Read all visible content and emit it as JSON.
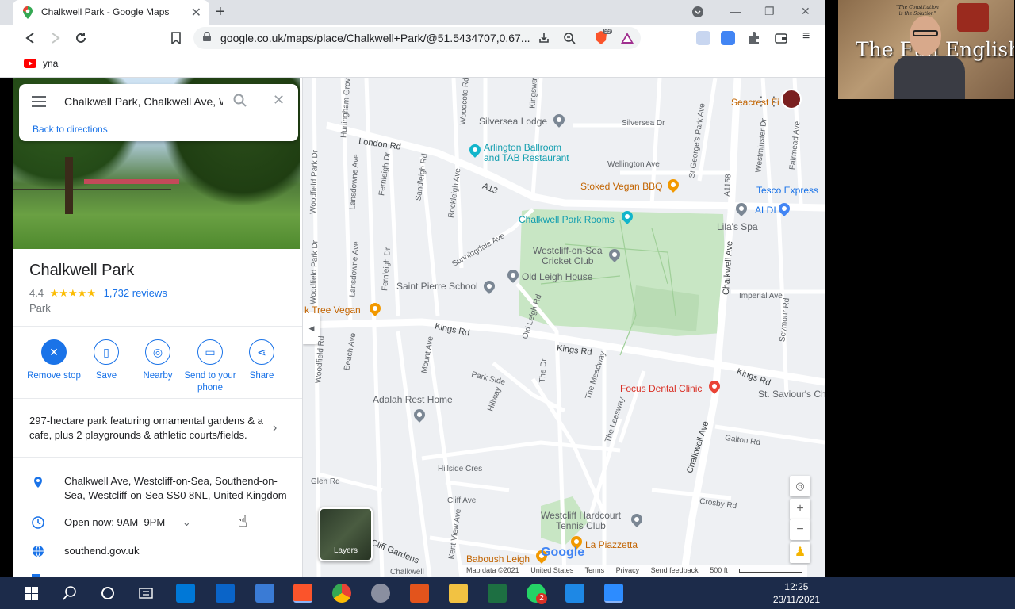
{
  "browser": {
    "tab_title": "Chalkwell Park - Google Maps",
    "url": "google.co.uk/maps/place/Chalkwell+Park/@51.5434707,0.67...",
    "bookmark_label": "yna",
    "brave_badge": "99"
  },
  "search": {
    "value": "Chalkwell Park, Chalkwell Ave, We",
    "back_link": "Back to directions"
  },
  "place": {
    "title": "Chalkwell Park",
    "rating": "4.4",
    "stars": "★★★★★",
    "reviews": "1,732 reviews",
    "type": "Park",
    "description": "297-hectare park featuring ornamental gardens & a cafe, plus 2 playgrounds & athletic courts/fields.",
    "address": "Chalkwell Ave, Westcliff-on-Sea, Southend-on-Sea, Westcliff-on-Sea SS0 8NL, United Kingdom",
    "hours": "Open now:  9AM–9PM",
    "website": "southend.gov.uk",
    "actions": [
      {
        "label": "Remove stop",
        "icon": "remove-stop-icon"
      },
      {
        "label": "Save",
        "icon": "bookmark-icon"
      },
      {
        "label": "Nearby",
        "icon": "nearby-icon"
      },
      {
        "label": "Send to your phone",
        "icon": "send-to-phone-icon"
      },
      {
        "label": "Share",
        "icon": "share-icon"
      }
    ]
  },
  "map": {
    "streets": {
      "london_rd": "London Rd",
      "a13": "A13",
      "kings_rd_1": "Kings Rd",
      "kings_rd_2": "Kings Rd",
      "kings_rd_3": "Kings Rd",
      "silversea_dr": "Silversea Dr",
      "wellington_ave": "Wellington Ave",
      "st_georges_park_ave": "St George's Park Ave",
      "a1158": "A1158",
      "chalkwell_ave_1": "Chalkwell Ave",
      "chalkwell_ave_2": "Chalkwell Ave",
      "imperial_ave": "Imperial Ave",
      "seymour_rd": "Seymour Rd",
      "westminster_dr": "Westminster Dr",
      "fairmead_ave": "Fairmead Ave",
      "sunningdale_ave": "Sunningdale Ave",
      "rockleigh_ave": "Rockleigh Ave",
      "sandleigh_rd": "Sandleigh Rd",
      "fernleigh_dr": "Fernleigh Dr",
      "lansdowne_ave": "Lansdowne Ave",
      "woodfield_park_dr": "Woodfield Park Dr",
      "woodfield_rd": "Woodfield Rd",
      "beach_ave": "Beach Ave",
      "mount_ave": "Mount Ave",
      "old_leigh_rd": "Old Leigh Rd",
      "the_dr": "The Dr",
      "the_meadway": "The Meadway",
      "the_leasway": "The Leasway",
      "park_side": "Park Side",
      "hillway": "Hillway",
      "hillside_cres": "Hillside Cres",
      "cliff_ave": "Cliff Ave",
      "glen_rd": "Glen Rd",
      "kent_view_ave": "Kent View Ave",
      "cliff_gardens": "Cliff Gardens",
      "galton_rd": "Galton Rd",
      "crosby_rd": "Crosby Rd",
      "woodcote_rd": "Woodcote Rd",
      "kingsway": "Kingsway",
      "hurlingham_grove": "Hurlingham Grove",
      "chalkwell_bottom": "Chalkwell"
    },
    "places": {
      "silversea_lodge": "Silversea Lodge",
      "arlington": "Arlington Ballroom\nand TAB Restaurant",
      "stoked_vegan": "Stoked Vegan BBQ",
      "tesco": "Tesco Express",
      "aldi": "ALDI",
      "lilas_spa": "Lila's Spa",
      "chalkwell_park_rooms": "Chalkwell Park Rooms",
      "cricket_club": "Westcliff-on-Sea\nCricket Club",
      "old_leigh_house": "Old Leigh House",
      "saint_pierre": "Saint Pierre School",
      "oak_tree_vegan": "k Tree Vegan",
      "focus_dental": "Focus Dental Clinic",
      "st_saviours": "St. Saviour's Ch",
      "adalah": "Adalah Rest Home",
      "hardcourt": "Westcliff Hardcourt\nTennis Club",
      "la_piazzetta": "La Piazzetta",
      "baboush": "Baboush Leigh",
      "seacrest": "Seacrest Fi"
    },
    "layers_label": "Layers",
    "google_logo": "Google",
    "attribution": {
      "map_data": "Map data ©2021",
      "region": "United States",
      "terms": "Terms",
      "privacy": "Privacy",
      "feedback": "Send feedback",
      "scale": "500 ft"
    }
  },
  "webcam": {
    "sign_text": "The Full English",
    "motto": "\"The Constitution is the Solution\""
  },
  "taskbar": {
    "time": "12:25",
    "date": "23/11/2021",
    "whatsapp_badge": "2"
  },
  "colors": {
    "accent": "#1a73e8",
    "star": "#fbbc04",
    "park_green": "#c8e6c4",
    "taskbar": "#1c2b4a"
  }
}
